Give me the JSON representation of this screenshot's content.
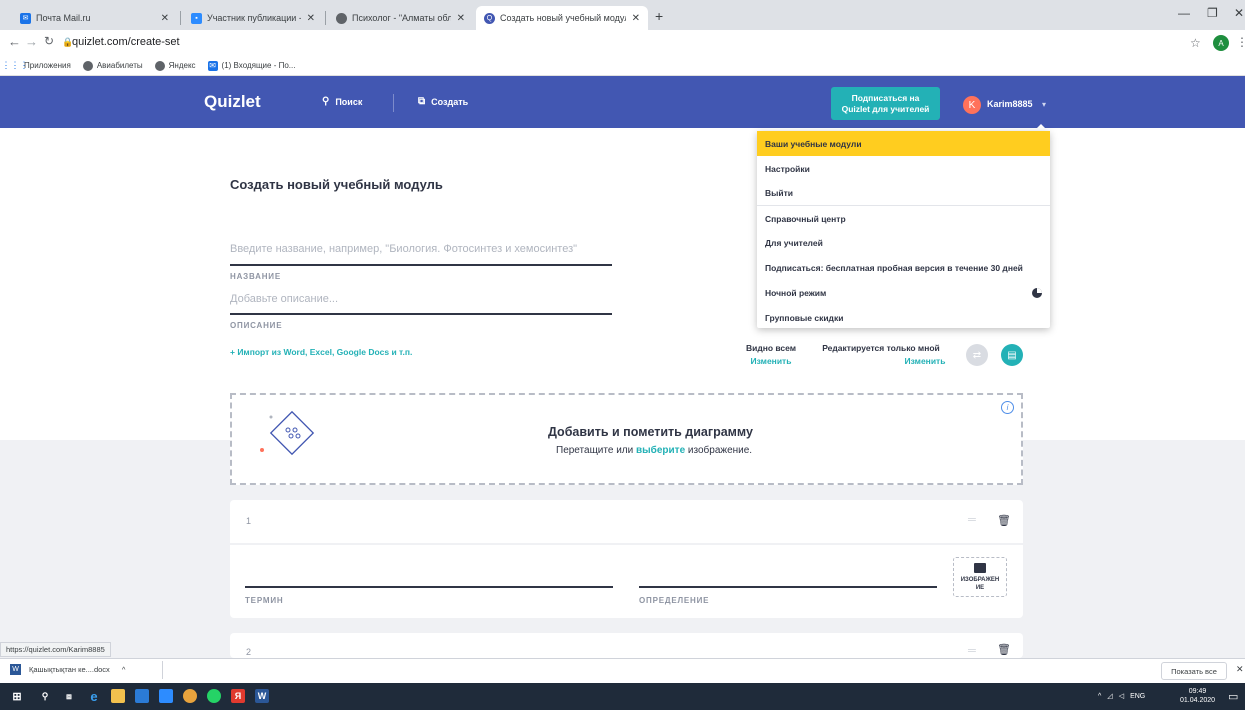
{
  "browser": {
    "tabs": [
      {
        "title": "Почта Mail.ru",
        "icon": "mail-icon",
        "color": "#1a73e8"
      },
      {
        "title": "Участник публикации - Zoom",
        "icon": "zoom-icon",
        "color": "#2d8cff"
      },
      {
        "title": "Психолог - \"Алматы облыстық",
        "icon": "globe-icon",
        "color": "#5f6368"
      },
      {
        "title": "Создать новый учебный модуль",
        "icon": "quizlet-icon",
        "color": "#4257b2"
      }
    ],
    "url": "quizlet.com/create-set",
    "profile_initial": "A",
    "bookmarks": [
      {
        "label": "Приложения",
        "icon": "apps-icon"
      },
      {
        "label": "Авиабилеты",
        "icon": "globe-icon"
      },
      {
        "label": "Яндекс",
        "icon": "globe-icon"
      },
      {
        "label": "(1) Входящие - По...",
        "icon": "mail-icon"
      }
    ]
  },
  "header": {
    "logo": "Quizlet",
    "search_label": "Поиск",
    "create_label": "Создать",
    "teacher_line1": "Подписаться на",
    "teacher_line2": "Quizlet для учителей",
    "avatar_initial": "K",
    "username": "Karim8885",
    "brand_color": "#4257b2",
    "accent_color": "#23b1b6"
  },
  "page": {
    "title": "Создать новый учебный модуль",
    "title_placeholder": "Введите название, например, \"Биология. Фотосинтез и хемосинтез\"",
    "title_caption": "НАЗВАНИЕ",
    "desc_placeholder": "Добавьте описание...",
    "desc_caption": "ОПИСАНИЕ",
    "import_link": "+ Импорт из Word, Excel, Google Docs и т.п.",
    "visibility_label": "Видно всем",
    "visibility_change": "Изменить",
    "edit_label": "Редактируется только мной",
    "edit_change": "Изменить"
  },
  "diagram": {
    "title": "Добавить и пометить диаграмму",
    "sub_before": "Перетащите или ",
    "sub_link": "выберите",
    "sub_after": " изображение."
  },
  "cards": [
    {
      "number": "1",
      "term_caption": "ТЕРМИН",
      "definition_caption": "ОПРЕДЕЛЕНИЕ",
      "image_label_1": "ИЗОБРАЖЕН",
      "image_label_2": "ИЕ"
    },
    {
      "number": "2"
    }
  ],
  "dropdown": {
    "items": [
      {
        "label": "Ваши учебные модули",
        "highlighted": true
      },
      {
        "label": "Настройки"
      },
      {
        "label": "Выйти"
      },
      {
        "label": "Справочный центр"
      },
      {
        "label": "Для учителей"
      },
      {
        "label": "Подписаться: бесплатная пробная версия в течение 30 дней"
      },
      {
        "label": "Ночной режим"
      },
      {
        "label": "Групповые скидки"
      }
    ],
    "highlight_color": "#ffcd1f"
  },
  "status_url": "https://quizlet.com/Karim8885",
  "downloads": {
    "file": "Қашықтықтан ке....docx",
    "show_all": "Показать все"
  },
  "taskbar": {
    "lang": "ENG",
    "time": "09:49",
    "date": "01.04.2020"
  }
}
